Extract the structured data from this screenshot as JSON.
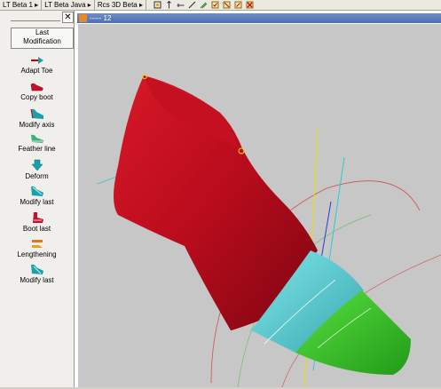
{
  "tabs": [
    "LT Beta 1 ▸",
    "LT Beta Java ▸",
    "Rcs 3D Beta ▸"
  ],
  "toolbar_icons": [
    "move-icon",
    "pointer-icon",
    "line-icon",
    "draw-icon",
    "pen-icon",
    "checkbox-icon",
    "select-icon",
    "edit-icon",
    "delete-icon"
  ],
  "panel": {
    "close": "✕",
    "title_line1": "Last",
    "title_line2": "Modification",
    "tools": [
      {
        "label": "Adapt Toe",
        "icon": "adapt-toe-icon"
      },
      {
        "label": "Copy boot",
        "icon": "copy-boot-icon"
      },
      {
        "label": "Modify axis",
        "icon": "modify-axis-icon"
      },
      {
        "label": "Feather line",
        "icon": "feather-line-icon"
      },
      {
        "label": "Deform",
        "icon": "deform-icon"
      },
      {
        "label": "Modify last",
        "icon": "modify-last-icon"
      },
      {
        "label": "Boot last",
        "icon": "boot-last-icon"
      },
      {
        "label": "Lengthening",
        "icon": "lengthening-icon"
      },
      {
        "label": "Modify last",
        "icon": "modify-last-2-icon"
      }
    ]
  },
  "viewport": {
    "title": "----- 12"
  },
  "colors": {
    "last_red": "#c00d1e",
    "toe_cyan": "#5ad0d6",
    "tip_green": "#3cc42a",
    "accent_yellow": "#e8e000",
    "viewport_bg": "#c7c7c7"
  }
}
